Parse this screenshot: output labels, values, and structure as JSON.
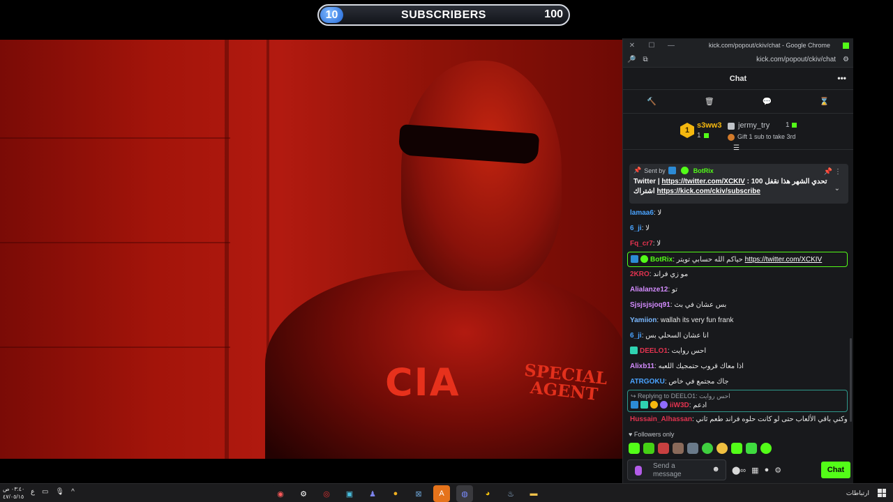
{
  "sub_goal": {
    "current": "10",
    "label": "SUBSCRIBERS",
    "target": "100"
  },
  "video": {
    "jacket_text": "CIA",
    "badge_text_line1": "SPECIAL",
    "badge_text_line2": "AGENT"
  },
  "browser": {
    "title": "kick.com/popout/ckiv/chat - Google Chrome",
    "url": "kick.com/popout/ckiv/chat"
  },
  "chat": {
    "header": "Chat",
    "more_glyph": "•••",
    "tools": [
      "🔨",
      "🗑",
      "💬",
      "⌛"
    ],
    "leaderboard": {
      "first": {
        "rank": "1",
        "name": "s3ww3",
        "count": "1"
      },
      "second": {
        "name": "jermy_try",
        "count": "1"
      },
      "gift_text": "Gift 1 sub to take 3rd"
    },
    "pinned": {
      "sent_by": "Sent by",
      "bot": "BotRix",
      "text_prefix": "Twitter | ",
      "link1": "https://twitter.com/XCKIV",
      "text_mid": " : تحدي الشهر هذا نقفل 100",
      "text_line2_prefix": "اشتراك ",
      "link2": "https://kick.com/ckiv/subscribe"
    },
    "messages": [
      {
        "user": "lamaa6",
        "text": "لا",
        "color": "#4aa3ff"
      },
      {
        "user": "6_ji",
        "text": "لا",
        "color": "#4aa3ff"
      },
      {
        "user": "Fq_cr7",
        "text": "لا",
        "color": "#e2334f"
      },
      {
        "user": "BotRix",
        "text": "حياكم الله حسابي تويتر ",
        "link": "https://twitter.com/XCKIV",
        "color": "#53fc18"
      },
      {
        "user": "2KRO",
        "text": "مو زي فراند",
        "color": "#e2334f"
      },
      {
        "user": "Alialanze12",
        "text": "تو",
        "color": "#d48cff"
      },
      {
        "user": "Sjsjsjsjoq91",
        "text": "بس عشان في بث",
        "color": "#d48cff"
      },
      {
        "user": "Yamiion",
        "text": "wallah its very fun frank",
        "color": "#7ab8ff"
      },
      {
        "user": "6_ji",
        "text": "انا عشان السحلي بس",
        "color": "#4aa3ff"
      },
      {
        "user": "DEELO1",
        "text": "احس روايت",
        "color": "#e2334f"
      },
      {
        "user": "Alixb11",
        "text": "اذا معاك قروب حتمجيك اللعبه",
        "color": "#d48cff"
      },
      {
        "user": "ATRGOKU",
        "text": "جاك مجتمع في خاص",
        "color": "#4aa3ff"
      }
    ],
    "reply": {
      "replying_to": "Replying to DEELO1:",
      "quoted": "احس روايت",
      "user": "iiW3D",
      "text": "ادعم"
    },
    "last_message": {
      "user": "Hussain_Alhassan",
      "text": "فراند وكني باقي الألعاب حتى لو كانت حلوه فراند طعم ثاني"
    },
    "followers_only": "Followers only",
    "input_placeholder": "Send a message",
    "send_button": "Chat"
  },
  "taskbar": {
    "time": "٠٣:٤٠ ص",
    "date": "٤٧/٠٥/١٥",
    "lang": "ع",
    "tray_label": "ارتباطات"
  },
  "colors": {
    "kick_green": "#53fc18",
    "chat_bg": "#18191c"
  }
}
